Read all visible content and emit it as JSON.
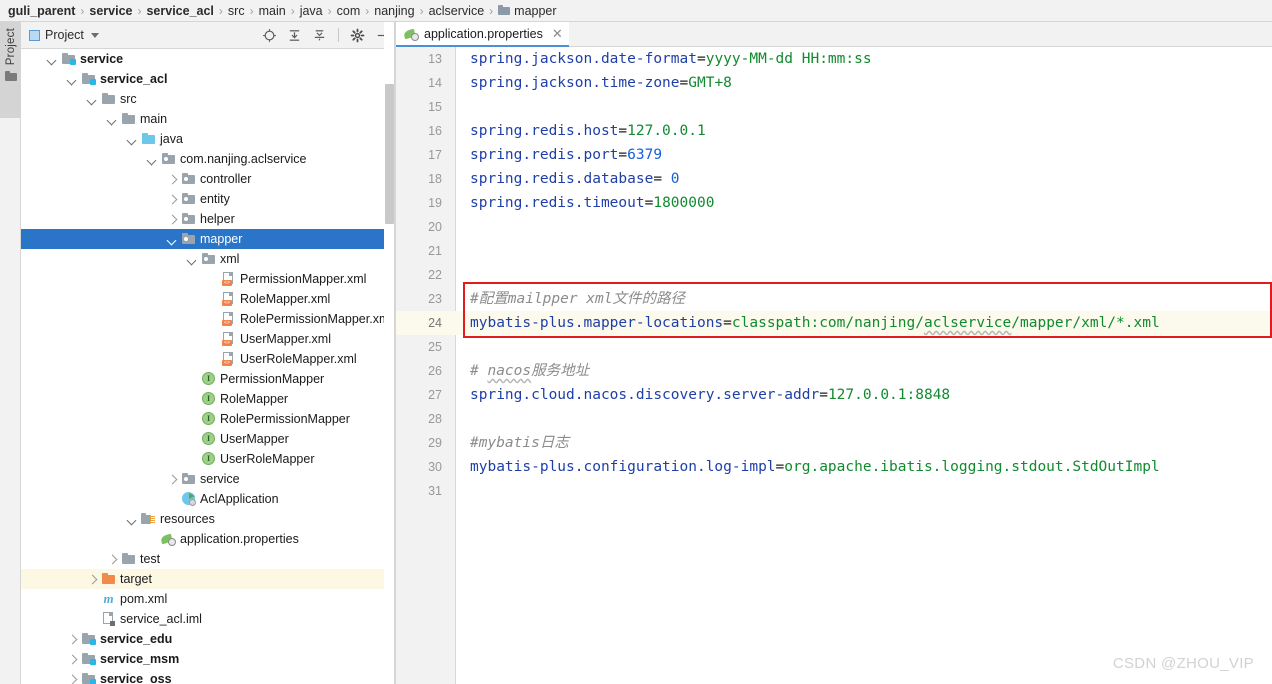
{
  "breadcrumb": {
    "separator": "›",
    "items": [
      {
        "label": "guli_parent",
        "bold": true,
        "icon": null
      },
      {
        "label": "service",
        "bold": true,
        "icon": null
      },
      {
        "label": "service_acl",
        "bold": true,
        "icon": null
      },
      {
        "label": "src",
        "bold": false,
        "icon": null
      },
      {
        "label": "main",
        "bold": false,
        "icon": null
      },
      {
        "label": "java",
        "bold": false,
        "icon": null
      },
      {
        "label": "com",
        "bold": false,
        "icon": null
      },
      {
        "label": "nanjing",
        "bold": false,
        "icon": null
      },
      {
        "label": "aclservice",
        "bold": false,
        "icon": null
      },
      {
        "label": "mapper",
        "bold": false,
        "icon": "folder-icon"
      }
    ]
  },
  "tool_strip": {
    "tab_label": "Project",
    "tab_icon": "project-folder-icon"
  },
  "project_panel": {
    "title": "Project",
    "title_icon": "project-view-icon",
    "dropdown_icon": "chevron-down-icon",
    "actions": [
      {
        "name": "select-opened-file-icon",
        "tooltip": "Select Opened File"
      },
      {
        "name": "expand-all-icon",
        "tooltip": "Expand All"
      },
      {
        "name": "collapse-all-icon",
        "tooltip": "Collapse All"
      },
      {
        "name": "settings-gear-icon",
        "tooltip": "Settings"
      },
      {
        "name": "hide-icon",
        "tooltip": "Hide"
      }
    ],
    "tree": [
      {
        "label": "service",
        "indent": 1,
        "arrow": "down",
        "icon": "module",
        "bold": true,
        "state": "normal"
      },
      {
        "label": "service_acl",
        "indent": 2,
        "arrow": "down",
        "icon": "module",
        "bold": true,
        "state": "normal"
      },
      {
        "label": "src",
        "indent": 3,
        "arrow": "down",
        "icon": "folder",
        "bold": false,
        "state": "normal"
      },
      {
        "label": "main",
        "indent": 4,
        "arrow": "down",
        "icon": "folder",
        "bold": false,
        "state": "normal"
      },
      {
        "label": "java",
        "indent": 5,
        "arrow": "down",
        "icon": "srcfolder",
        "bold": false,
        "state": "normal"
      },
      {
        "label": "com.nanjing.aclservice",
        "indent": 6,
        "arrow": "down",
        "icon": "pkg",
        "bold": false,
        "state": "normal"
      },
      {
        "label": "controller",
        "indent": 7,
        "arrow": "right",
        "icon": "pkg",
        "bold": false,
        "state": "normal"
      },
      {
        "label": "entity",
        "indent": 7,
        "arrow": "right",
        "icon": "pkg",
        "bold": false,
        "state": "normal"
      },
      {
        "label": "helper",
        "indent": 7,
        "arrow": "right",
        "icon": "pkg",
        "bold": false,
        "state": "normal"
      },
      {
        "label": "mapper",
        "indent": 7,
        "arrow": "down",
        "icon": "pkg",
        "bold": false,
        "state": "selected"
      },
      {
        "label": "xml",
        "indent": 8,
        "arrow": "down",
        "icon": "pkg",
        "bold": false,
        "state": "normal"
      },
      {
        "label": "PermissionMapper.xml",
        "indent": 9,
        "arrow": "none",
        "icon": "xmlfile",
        "bold": false,
        "state": "normal"
      },
      {
        "label": "RoleMapper.xml",
        "indent": 9,
        "arrow": "none",
        "icon": "xmlfile",
        "bold": false,
        "state": "normal"
      },
      {
        "label": "RolePermissionMapper.xm",
        "indent": 9,
        "arrow": "none",
        "icon": "xmlfile",
        "bold": false,
        "state": "normal"
      },
      {
        "label": "UserMapper.xml",
        "indent": 9,
        "arrow": "none",
        "icon": "xmlfile",
        "bold": false,
        "state": "normal"
      },
      {
        "label": "UserRoleMapper.xml",
        "indent": 9,
        "arrow": "none",
        "icon": "xmlfile",
        "bold": false,
        "state": "normal"
      },
      {
        "label": "PermissionMapper",
        "indent": 8,
        "arrow": "none",
        "icon": "iface",
        "bold": false,
        "state": "normal"
      },
      {
        "label": "RoleMapper",
        "indent": 8,
        "arrow": "none",
        "icon": "iface",
        "bold": false,
        "state": "normal"
      },
      {
        "label": "RolePermissionMapper",
        "indent": 8,
        "arrow": "none",
        "icon": "iface",
        "bold": false,
        "state": "normal"
      },
      {
        "label": "UserMapper",
        "indent": 8,
        "arrow": "none",
        "icon": "iface",
        "bold": false,
        "state": "normal"
      },
      {
        "label": "UserRoleMapper",
        "indent": 8,
        "arrow": "none",
        "icon": "iface",
        "bold": false,
        "state": "normal"
      },
      {
        "label": "service",
        "indent": 7,
        "arrow": "right",
        "icon": "pkg",
        "bold": false,
        "state": "normal"
      },
      {
        "label": "AclApplication",
        "indent": 7,
        "arrow": "none",
        "icon": "springapp",
        "bold": false,
        "state": "normal"
      },
      {
        "label": "resources",
        "indent": 5,
        "arrow": "down",
        "icon": "resources",
        "bold": false,
        "state": "normal"
      },
      {
        "label": "application.properties",
        "indent": 6,
        "arrow": "none",
        "icon": "props",
        "bold": false,
        "state": "normal"
      },
      {
        "label": "test",
        "indent": 4,
        "arrow": "right",
        "icon": "folder",
        "bold": false,
        "state": "normal"
      },
      {
        "label": "target",
        "indent": 3,
        "arrow": "right",
        "icon": "orange",
        "bold": false,
        "state": "highlight"
      },
      {
        "label": "pom.xml",
        "indent": 3,
        "arrow": "none",
        "icon": "maven",
        "bold": false,
        "state": "normal"
      },
      {
        "label": "service_acl.iml",
        "indent": 3,
        "arrow": "none",
        "icon": "iml",
        "bold": false,
        "state": "normal"
      },
      {
        "label": "service_edu",
        "indent": 2,
        "arrow": "right",
        "icon": "module",
        "bold": true,
        "state": "normal"
      },
      {
        "label": "service_msm",
        "indent": 2,
        "arrow": "right",
        "icon": "module",
        "bold": true,
        "state": "normal"
      },
      {
        "label": "service_oss",
        "indent": 2,
        "arrow": "right",
        "icon": "module",
        "bold": true,
        "state": "normal"
      }
    ]
  },
  "editor": {
    "tab": {
      "label": "application.properties",
      "icon": "properties-file-icon",
      "close_icon": "close-icon",
      "active": true
    },
    "first_visible_line": 13,
    "current_line": 24,
    "lines": [
      {
        "num": 13,
        "segments": [
          {
            "t": "spring.jackson.date-format",
            "c": "key"
          },
          {
            "t": "=",
            "c": "eq"
          },
          {
            "t": "yyyy-MM-dd HH:mm:ss",
            "c": "val"
          }
        ]
      },
      {
        "num": 14,
        "segments": [
          {
            "t": "spring.jackson.time-zone",
            "c": "key"
          },
          {
            "t": "=",
            "c": "eq"
          },
          {
            "t": "GMT+8",
            "c": "val"
          }
        ]
      },
      {
        "num": 15,
        "segments": []
      },
      {
        "num": 16,
        "segments": [
          {
            "t": "spring.redis.host",
            "c": "key"
          },
          {
            "t": "=",
            "c": "eq"
          },
          {
            "t": "127.0.0.1",
            "c": "val"
          }
        ]
      },
      {
        "num": 17,
        "segments": [
          {
            "t": "spring.redis.port",
            "c": "key"
          },
          {
            "t": "=",
            "c": "eq"
          },
          {
            "t": "6379",
            "c": "num"
          }
        ]
      },
      {
        "num": 18,
        "segments": [
          {
            "t": "spring.redis.database",
            "c": "key"
          },
          {
            "t": "= ",
            "c": "eq"
          },
          {
            "t": "0",
            "c": "num"
          }
        ]
      },
      {
        "num": 19,
        "segments": [
          {
            "t": "spring.redis.timeout",
            "c": "key"
          },
          {
            "t": "=",
            "c": "eq"
          },
          {
            "t": "1800000",
            "c": "val"
          }
        ]
      },
      {
        "num": 20,
        "segments": []
      },
      {
        "num": 21,
        "segments": []
      },
      {
        "num": 22,
        "segments": []
      },
      {
        "num": 23,
        "segments": [
          {
            "t": "#配置mailpper xml文件的路径",
            "c": "cmt"
          }
        ]
      },
      {
        "num": 24,
        "segments": [
          {
            "t": "mybatis-plus.mapper-locations",
            "c": "key"
          },
          {
            "t": "=",
            "c": "eq"
          },
          {
            "t": "classpath:com/nanjing/",
            "c": "val"
          },
          {
            "t": "aclservice",
            "c": "val-squiggle"
          },
          {
            "t": "/mapper/xml/*.xml",
            "c": "val"
          }
        ]
      },
      {
        "num": 25,
        "segments": []
      },
      {
        "num": 26,
        "segments": [
          {
            "t": "# ",
            "c": "cmt"
          },
          {
            "t": "nacos",
            "c": "cmt-squiggle"
          },
          {
            "t": "服务地址",
            "c": "cmt"
          }
        ]
      },
      {
        "num": 27,
        "segments": [
          {
            "t": "spring.cloud.nacos.discovery.server-addr",
            "c": "key"
          },
          {
            "t": "=",
            "c": "eq"
          },
          {
            "t": "127.0.0.1:8848",
            "c": "val"
          }
        ]
      },
      {
        "num": 28,
        "segments": []
      },
      {
        "num": 29,
        "segments": [
          {
            "t": "#mybatis日志",
            "c": "cmt"
          }
        ]
      },
      {
        "num": 30,
        "segments": [
          {
            "t": "mybatis-plus.configuration.log-impl",
            "c": "key"
          },
          {
            "t": "=",
            "c": "eq"
          },
          {
            "t": "org.apache.ibatis.logging.stdout.StdOutImpl",
            "c": "val"
          }
        ]
      },
      {
        "num": 31,
        "segments": []
      }
    ],
    "annotation_box": {
      "name": "red-highlight-box",
      "color": "#e31b1b",
      "covers_lines": [
        23,
        24
      ]
    }
  },
  "watermark": {
    "text": "CSDN @ZHOU_VIP"
  },
  "colors": {
    "selection_blue": "#2a75c8",
    "highlight_yellow": "#fdf8e3",
    "current_line": "#fcfaec",
    "annotation_red": "#e31b1b",
    "chrome_gray": "#f2f2f2"
  }
}
